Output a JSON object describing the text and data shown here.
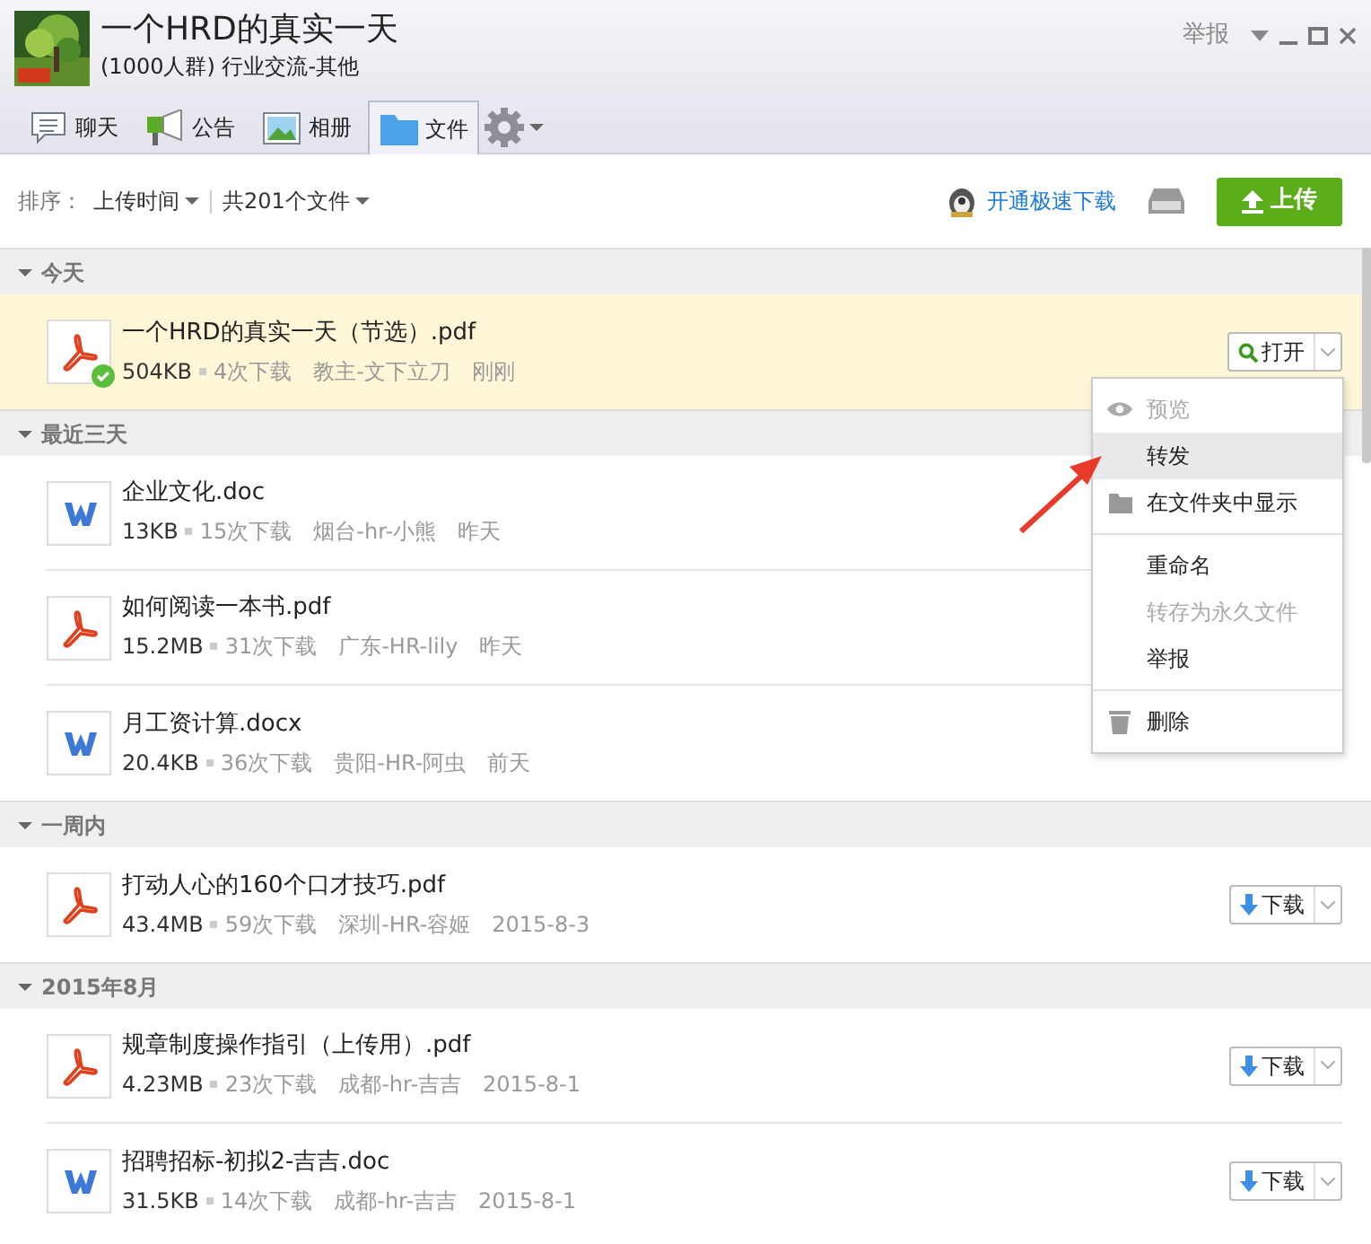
{
  "window": {
    "title": "一个HRD的真实一天",
    "subtitle": "(1000人群) 行业交流-其他",
    "report": "举报"
  },
  "tabs": [
    {
      "label": "聊天",
      "selected": false
    },
    {
      "label": "公告",
      "selected": false
    },
    {
      "label": "相册",
      "selected": false
    },
    {
      "label": "文件",
      "selected": true
    }
  ],
  "toolbar": {
    "sort_label": "排序：",
    "sort_value": "上传时间",
    "count": "共201个文件",
    "speed_link": "开通极速下载",
    "upload_button": "上传"
  },
  "groups": [
    {
      "label": "今天",
      "expanded": true,
      "files": [
        {
          "kind": "pdf",
          "name": "一个HRD的真实一天（节选）.pdf",
          "size": "504KB",
          "downloads": "4次下载",
          "uploader": "教主-文下立刀",
          "time": "刚刚",
          "selected": true,
          "downloaded": true,
          "action": {
            "kind": "open",
            "label": "打开"
          }
        }
      ]
    },
    {
      "label": "最近三天",
      "expanded": true,
      "files": [
        {
          "kind": "doc",
          "name": "企业文化.doc",
          "size": "13KB",
          "downloads": "15次下载",
          "uploader": "烟台-hr-小熊",
          "time": "昨天",
          "selected": false,
          "downloaded": false
        },
        {
          "kind": "pdf",
          "name": "如何阅读一本书.pdf",
          "size": "15.2MB",
          "downloads": "31次下载",
          "uploader": "广东-HR-lily",
          "time": "昨天",
          "selected": false,
          "downloaded": false
        },
        {
          "kind": "doc",
          "name": "月工资计算.docx",
          "size": "20.4KB",
          "downloads": "36次下载",
          "uploader": "贵阳-HR-阿虫",
          "time": "前天",
          "selected": false,
          "downloaded": false
        }
      ]
    },
    {
      "label": "一周内",
      "expanded": true,
      "files": [
        {
          "kind": "pdf",
          "name": "打动人心的160个口才技巧.pdf",
          "size": "43.4MB",
          "downloads": "59次下载",
          "uploader": "深圳-HR-容姬",
          "time": "2015-8-3",
          "selected": false,
          "downloaded": false,
          "action": {
            "kind": "download",
            "label": "下载"
          }
        }
      ]
    },
    {
      "label": "2015年8月",
      "expanded": true,
      "files": [
        {
          "kind": "pdf",
          "name": "规章制度操作指引（上传用）.pdf",
          "size": "4.23MB",
          "downloads": "23次下载",
          "uploader": "成都-hr-吉吉",
          "time": "2015-8-1",
          "selected": false,
          "downloaded": false,
          "action": {
            "kind": "download",
            "label": "下载"
          }
        },
        {
          "kind": "doc",
          "name": "招聘招标-初拟2-吉吉.doc",
          "size": "31.5KB",
          "downloads": "14次下载",
          "uploader": "成都-hr-吉吉",
          "time": "2015-8-1",
          "selected": false,
          "downloaded": false,
          "action": {
            "kind": "download",
            "label": "下载"
          }
        }
      ]
    }
  ],
  "context_menu": {
    "sections": [
      [
        {
          "label": "预览",
          "disabled": true,
          "selected": false
        },
        {
          "label": "转发",
          "disabled": false,
          "selected": true
        },
        {
          "label": "在文件夹中显示",
          "disabled": false,
          "selected": false
        }
      ],
      [
        {
          "label": "重命名",
          "disabled": false,
          "selected": false
        },
        {
          "label": "转存为永久文件",
          "disabled": true,
          "selected": false
        },
        {
          "label": "举报",
          "disabled": false,
          "selected": false
        }
      ],
      [
        {
          "label": "删除",
          "disabled": false,
          "selected": false
        }
      ]
    ]
  }
}
